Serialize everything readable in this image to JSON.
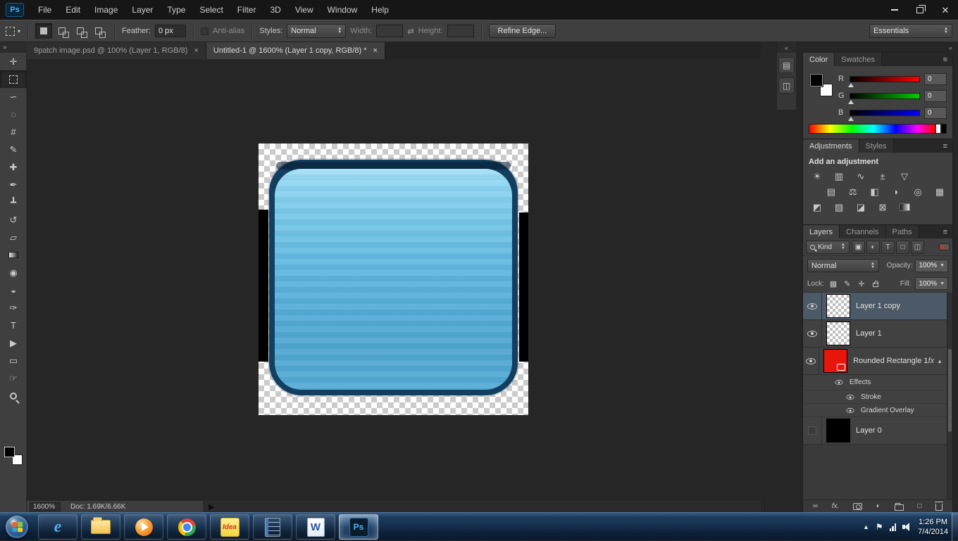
{
  "app": {
    "logo": "Ps"
  },
  "menu": {
    "items": [
      "File",
      "Edit",
      "Image",
      "Layer",
      "Type",
      "Select",
      "Filter",
      "3D",
      "View",
      "Window",
      "Help"
    ]
  },
  "options": {
    "feather_label": "Feather:",
    "feather_value": "0 px",
    "antialias_label": "Anti-alias",
    "style_label": "Styles:",
    "style_value": "Normal",
    "width_label": "Width:",
    "width_value": "",
    "height_label": "Height:",
    "height_value": "",
    "refine_edge_label": "Refine Edge...",
    "workspace_value": "Essentials"
  },
  "doc_tabs": [
    {
      "title": "9patch image.psd @ 100% (Layer 1, RGB/8)",
      "active": false
    },
    {
      "title": "Untitled-1 @ 1600% (Layer 1 copy, RGB/8) *",
      "active": true
    }
  ],
  "tools": [
    "move",
    "rectangular-marquee",
    "lasso",
    "quick-selection",
    "crop",
    "eyedropper",
    "spot-healing",
    "brush",
    "clone-stamp",
    "history-brush",
    "eraser",
    "gradient",
    "blur",
    "dodge",
    "pen",
    "type",
    "path-selection",
    "rectangle",
    "hand",
    "zoom"
  ],
  "status": {
    "zoom": "1600%",
    "doc_info": "Doc: 1.69K/6.66K"
  },
  "color_panel": {
    "tabs": [
      "Color",
      "Swatches"
    ],
    "active_tab": "Color",
    "channels": [
      {
        "label": "R",
        "value": "0",
        "color": "#ff0000"
      },
      {
        "label": "G",
        "value": "0",
        "color": "#00cc00"
      },
      {
        "label": "B",
        "value": "0",
        "color": "#0000ff"
      }
    ]
  },
  "adjustments_panel": {
    "tabs": [
      "Adjustments",
      "Styles"
    ],
    "active_tab": "Adjustments",
    "heading": "Add an adjustment",
    "icon_rows": [
      [
        "brightness-contrast",
        "levels",
        "curves",
        "exposure",
        "vibrance"
      ],
      [
        "hue-saturation",
        "color-balance",
        "black-white",
        "photo-filter",
        "channel-mixer",
        "color-lookup"
      ],
      [
        "invert",
        "posterize",
        "threshold",
        "selective-color",
        "gradient-map"
      ]
    ]
  },
  "layers_panel": {
    "tabs": [
      "Layers",
      "Channels",
      "Paths"
    ],
    "active_tab": "Layers",
    "kind_label": "Kind",
    "filter_icons": [
      "pixel-filter",
      "adjustment-filter",
      "type-filter",
      "shape-filter",
      "smart-object-filter"
    ],
    "blend_mode": "Normal",
    "opacity_label": "Opacity:",
    "opacity_value": "100%",
    "lock_label": "Lock:",
    "fill_label": "Fill:",
    "fill_value": "100%",
    "rows": [
      {
        "name": "Layer 1 copy",
        "thumb": "checker",
        "eye": true,
        "selected": true
      },
      {
        "name": "Layer 1",
        "thumb": "checker",
        "eye": true
      },
      {
        "name": "Rounded Rectangle 1",
        "thumb": "shape-red",
        "eye": true,
        "fx": "fx"
      },
      {
        "name": "Effects",
        "type": "effects-header",
        "eye": true
      },
      {
        "name": "Stroke",
        "type": "effect",
        "eye": true
      },
      {
        "name": "Gradient Overlay",
        "type": "effect",
        "eye": true
      },
      {
        "name": "Layer 0",
        "thumb": "black",
        "eye": false
      }
    ]
  },
  "taskbar": {
    "apps": [
      {
        "id": "internet-explorer",
        "label": "e"
      },
      {
        "id": "file-explorer"
      },
      {
        "id": "media-player"
      },
      {
        "id": "chrome"
      },
      {
        "id": "idea",
        "label": "Idea"
      },
      {
        "id": "notes"
      },
      {
        "id": "word",
        "label": "W"
      },
      {
        "id": "photoshop",
        "label": "Ps",
        "active": true
      }
    ],
    "clock": {
      "time": "1:26 PM",
      "date": "7/4/2014"
    }
  }
}
